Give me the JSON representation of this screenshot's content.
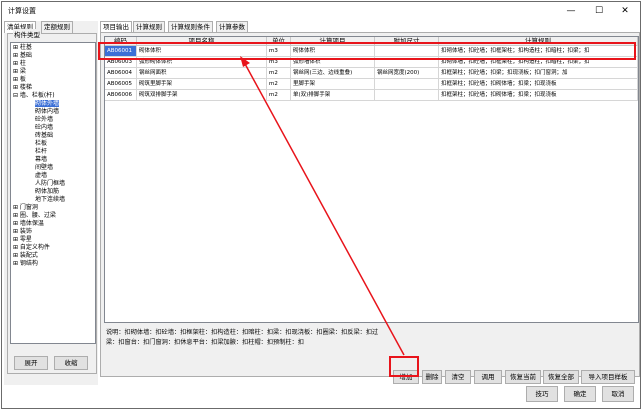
{
  "window": {
    "title": "计算设置",
    "min_icon": "minimize-icon",
    "max_icon": "maximize-icon",
    "close_icon": "close-icon"
  },
  "left_tabs": [
    "清单规则",
    "定额规则"
  ],
  "component_group_label": "构件类型",
  "tree": [
    {
      "text": "⊞ 柱基",
      "level": 0
    },
    {
      "text": "⊞ 基础",
      "level": 0
    },
    {
      "text": "⊞ 柱",
      "level": 0
    },
    {
      "text": "⊞ 梁",
      "level": 0
    },
    {
      "text": "⊞ 板",
      "level": 0
    },
    {
      "text": "⊞ 楼梯",
      "level": 0
    },
    {
      "text": "⊟ 墙、栏板(杆)",
      "level": 0
    },
    {
      "text": "砌体外墙",
      "level": 2,
      "selected": true
    },
    {
      "text": "砌体内墙",
      "level": 2
    },
    {
      "text": "砼外墙",
      "level": 2
    },
    {
      "text": "砼内墙",
      "level": 2
    },
    {
      "text": "砖基础",
      "level": 2
    },
    {
      "text": "栏板",
      "level": 2
    },
    {
      "text": "栏杆",
      "level": 2
    },
    {
      "text": "幕墙",
      "level": 2
    },
    {
      "text": "间壁墙",
      "level": 2
    },
    {
      "text": "虚墙",
      "level": 2
    },
    {
      "text": "人防门框墙",
      "level": 2
    },
    {
      "text": "砌体加筋",
      "level": 2
    },
    {
      "text": "地下连续墙",
      "level": 2
    },
    {
      "text": "⊞ 门窗洞",
      "level": 0
    },
    {
      "text": "⊞ 圈、腰、过梁",
      "level": 0
    },
    {
      "text": "⊞ 墙体保温",
      "level": 0
    },
    {
      "text": "⊞ 装饰",
      "level": 0
    },
    {
      "text": "⊞ 零星",
      "level": 0
    },
    {
      "text": "⊞ 自定义构件",
      "level": 0
    },
    {
      "text": "⊞ 装配式",
      "level": 0
    },
    {
      "text": "⊞ 钢结构",
      "level": 0
    }
  ],
  "left_buttons": {
    "expand": "展开",
    "collapse": "收缩"
  },
  "right_tabs": [
    "项目输出",
    "计算规则",
    "计算规则条件",
    "计算参数"
  ],
  "table": {
    "headers": [
      "编码",
      "项目名称",
      "单位",
      "计算项目",
      "附加尺寸",
      "计算规则"
    ],
    "rows": [
      [
        "AB06001",
        "砌体体积",
        "m3",
        "砌体体积",
        "",
        "扣砌体墙；扣砼墙；扣框架柱；扣构造柱；扣暗柱；扣梁；扣"
      ],
      [
        "AB06003",
        "弧形砌体体积",
        "m3",
        "弧形墙体积",
        "",
        "扣砌体墙；扣砼墙；扣框架柱；扣构造柱；扣暗柱；扣梁；扣"
      ],
      [
        "AB06004",
        "钢丝网面积",
        "m2",
        "钢丝网(三边、边线重叠)",
        "钢丝网宽度(200)",
        "扣框架柱；扣砼墙；扣梁；扣现浇板；扣门窗洞；加"
      ],
      [
        "AB06005",
        "砌筑里脚手架",
        "m2",
        "里脚手架",
        "",
        "扣框架柱；扣砼墙；扣砌体墙；扣梁；扣现浇板"
      ],
      [
        "AB06006",
        "砌筑双排脚手架",
        "m2",
        "单(双)排脚手架",
        "",
        "扣框架柱；扣砼墙；扣砌体墙；扣梁；扣现浇板"
      ]
    ]
  },
  "note": "说明：扣砌体墙：扣砼墙：扣框架柱：扣构造柱：扣暗柱：扣梁：扣现浇板：扣圈梁：扣反梁：扣过梁：扣窗台：扣门窗洞：扣休息平台：扣梁加腋：扣柱帽：扣预制柱：扣",
  "action_buttons": [
    "增加",
    "删除",
    "清空",
    "调用",
    "恢复当前",
    "恢复全部",
    "导入项目样板"
  ],
  "bottom_buttons": [
    "技巧",
    "确定",
    "取消"
  ],
  "highlight_color": "#e8141b",
  "selection_color": "#3b6fd6"
}
